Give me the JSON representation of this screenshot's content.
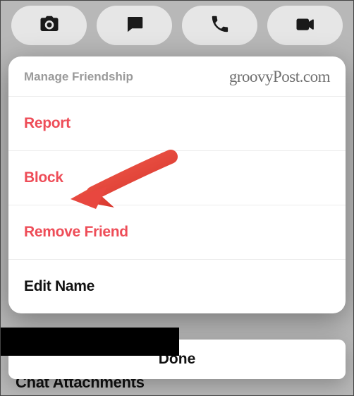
{
  "toolbar": {
    "camera": "camera",
    "chat": "chat",
    "call": "call",
    "video": "video"
  },
  "sheet": {
    "title": "Manage Friendship",
    "watermark": "groovyPost.com",
    "items": [
      {
        "label": "Report",
        "destructive": true
      },
      {
        "label": "Block",
        "destructive": true
      },
      {
        "label": "Remove Friend",
        "destructive": true
      },
      {
        "label": "Edit Name",
        "destructive": false
      }
    ]
  },
  "done_label": "Done",
  "background_hint": "Chat Attachments",
  "annotation": {
    "type": "arrow",
    "target": "block-option",
    "color": "#e8473f"
  }
}
